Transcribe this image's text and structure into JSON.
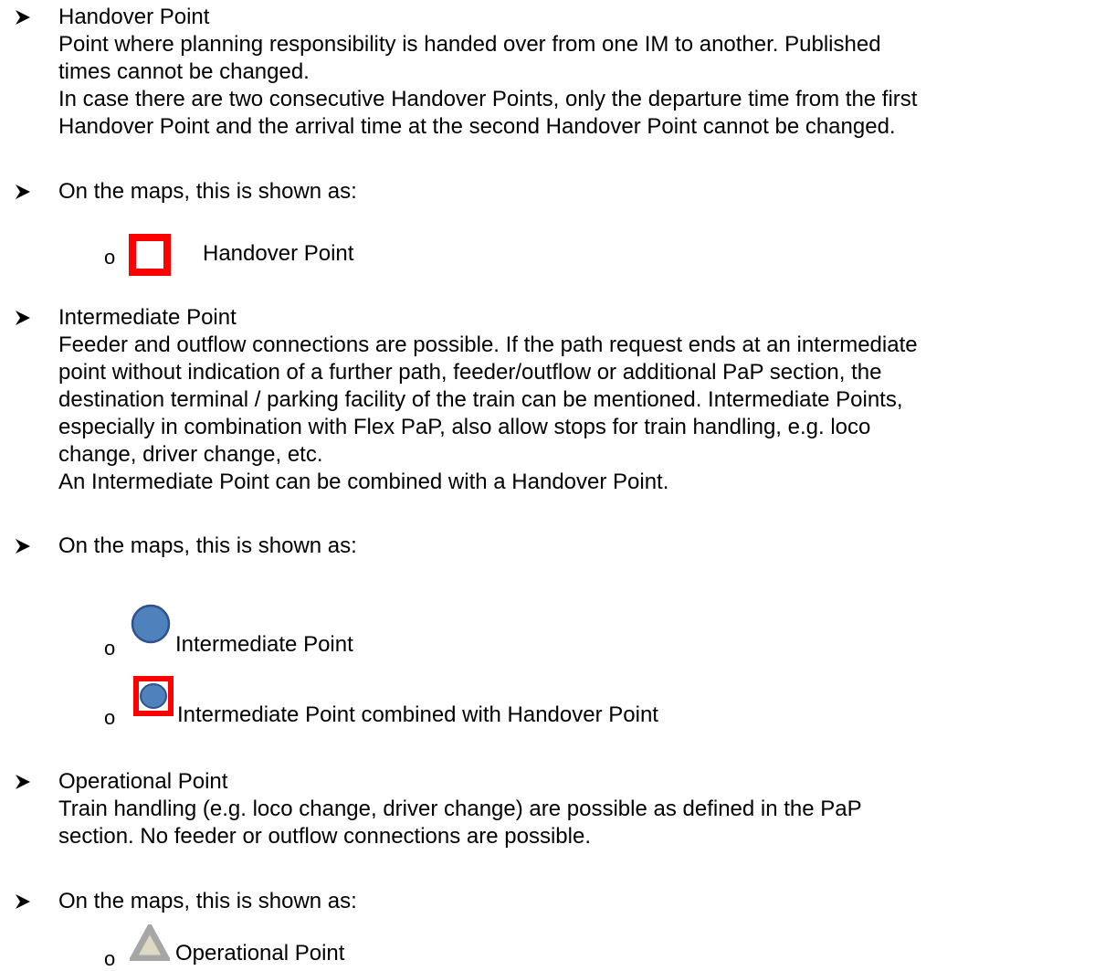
{
  "sections": [
    {
      "heading": "Handover Point",
      "lines": [
        "Point where planning responsibility is handed over from one IM to another. Published",
        "times cannot be changed.",
        "In case there are two consecutive Handover Points, only the departure time from the first",
        "Handover Point and the arrival time at the second Handover Point cannot be changed."
      ],
      "maps_text": "On the maps, this is shown as:",
      "legend": [
        {
          "icon": "red-square-icon",
          "label": "Handover Point"
        }
      ]
    },
    {
      "heading": "Intermediate Point",
      "lines": [
        "Feeder and outflow connections are possible. If the path request ends at an intermediate",
        "point without indication of a further path, feeder/outflow or additional PaP section, the",
        "destination terminal / parking facility of the train can be mentioned. Intermediate Points,",
        "especially in combination with Flex PaP, also allow stops for train handling, e.g. loco",
        "change, driver change, etc.",
        "An Intermediate Point can be combined with a Handover Point."
      ],
      "maps_text": "On the maps, this is shown as:",
      "legend": [
        {
          "icon": "blue-circle-icon",
          "label": "Intermediate Point"
        },
        {
          "icon": "blue-circle-in-red-square-icon",
          "label": "Intermediate Point combined with Handover Point"
        }
      ]
    },
    {
      "heading": "Operational Point",
      "lines": [
        "Train handling (e.g. loco change, driver change) are possible as defined in the PaP",
        "section. No feeder or outflow connections are possible."
      ],
      "maps_text": "On the maps, this is shown as:",
      "legend": [
        {
          "icon": "grey-triangle-icon",
          "label": "Operational Point"
        }
      ]
    }
  ],
  "colors": {
    "handover_red": "#ff0000",
    "intermediate_blue": "#4f81bd",
    "intermediate_blue_border": "#2f528f",
    "operational_grey": "#a6a6a6",
    "operational_fill": "#ddd9c3"
  },
  "bullet_glyph": "o"
}
